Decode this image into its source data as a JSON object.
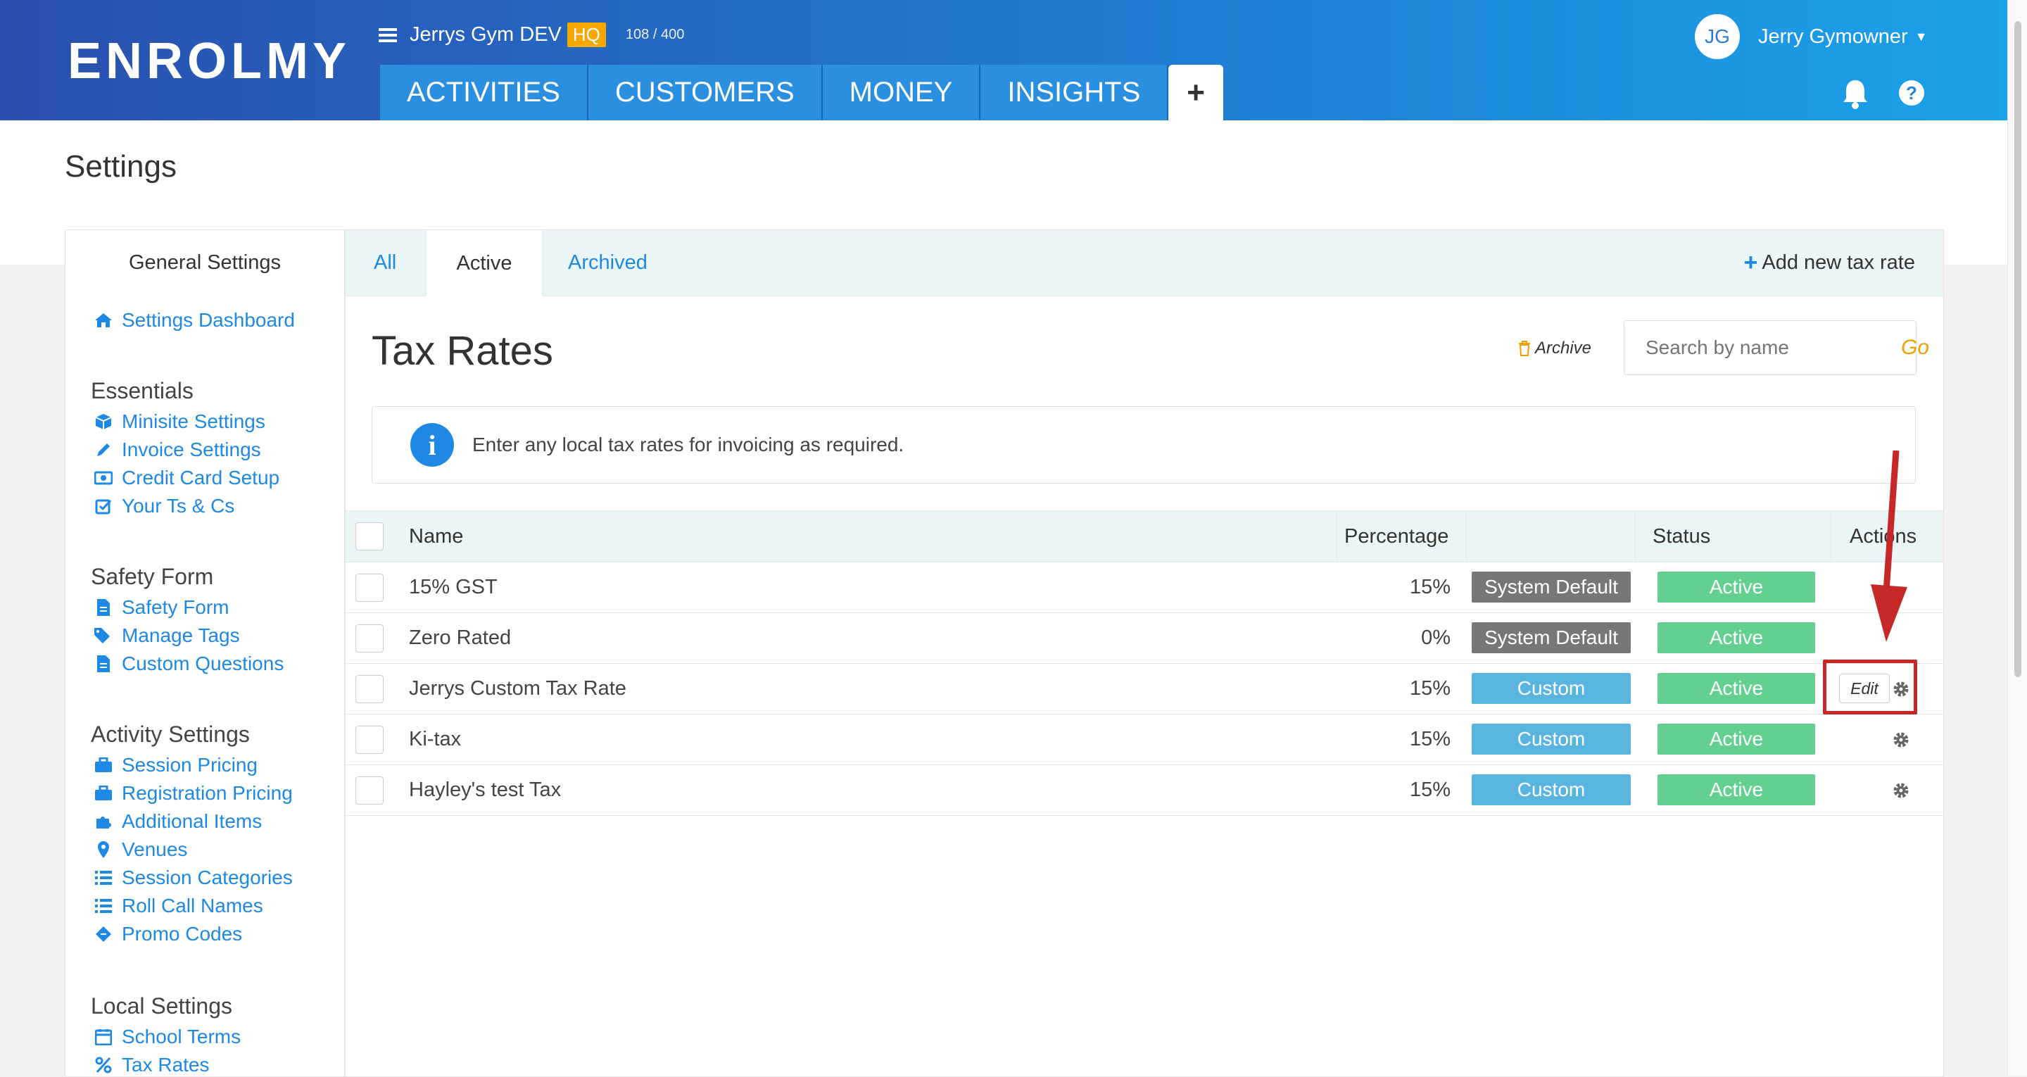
{
  "brand": {
    "logo": "ENROLMY"
  },
  "org": {
    "name": "Jerrys Gym DEV",
    "badge": "HQ",
    "count": "108 / 400"
  },
  "nav": {
    "tabs": [
      "ACTIVITIES",
      "CUSTOMERS",
      "MONEY",
      "INSIGHTS"
    ],
    "plus": "+"
  },
  "user": {
    "initials": "JG",
    "name": "Jerry Gymowner"
  },
  "page": {
    "title": "Settings"
  },
  "sidebar": {
    "heading": "General Settings",
    "dashboard": "Settings Dashboard",
    "sections": [
      {
        "title": "Essentials",
        "items": [
          "Minisite Settings",
          "Invoice Settings",
          "Credit Card Setup",
          "Your Ts & Cs"
        ]
      },
      {
        "title": "Safety Form",
        "items": [
          "Safety Form",
          "Manage Tags",
          "Custom Questions"
        ]
      },
      {
        "title": "Activity Settings",
        "items": [
          "Session Pricing",
          "Registration Pricing",
          "Additional Items",
          "Venues",
          "Session Categories",
          "Roll Call Names",
          "Promo Codes"
        ]
      },
      {
        "title": "Local Settings",
        "items": [
          "School Terms",
          "Tax Rates"
        ]
      }
    ]
  },
  "tabs": {
    "all": "All",
    "active": "Active",
    "archived": "Archived",
    "add_new": "Add new tax rate"
  },
  "main": {
    "title": "Tax Rates",
    "archive": "Archive",
    "search": {
      "placeholder": "Search by name",
      "go": "Go"
    },
    "info": "Enter any local tax rates for invoicing as required."
  },
  "table": {
    "headers": {
      "name": "Name",
      "percentage": "Percentage",
      "status": "Status",
      "actions": "Actions"
    },
    "rows": [
      {
        "name": "15% GST",
        "percentage": "15%",
        "type": "System Default",
        "status": "Active"
      },
      {
        "name": "Zero Rated",
        "percentage": "0%",
        "type": "System Default",
        "status": "Active"
      },
      {
        "name": "Jerrys Custom Tax Rate",
        "percentage": "15%",
        "type": "Custom",
        "status": "Active",
        "action": "Edit"
      },
      {
        "name": "Ki-tax",
        "percentage": "15%",
        "type": "Custom",
        "status": "Active"
      },
      {
        "name": "Hayley's test Tax",
        "percentage": "15%",
        "type": "Custom",
        "status": "Active"
      }
    ]
  },
  "colors": {
    "system_default": "#777777",
    "custom": "#5ab4e0",
    "active": "#63d08f",
    "link": "#1e88e5",
    "highlight": "#c62828"
  }
}
